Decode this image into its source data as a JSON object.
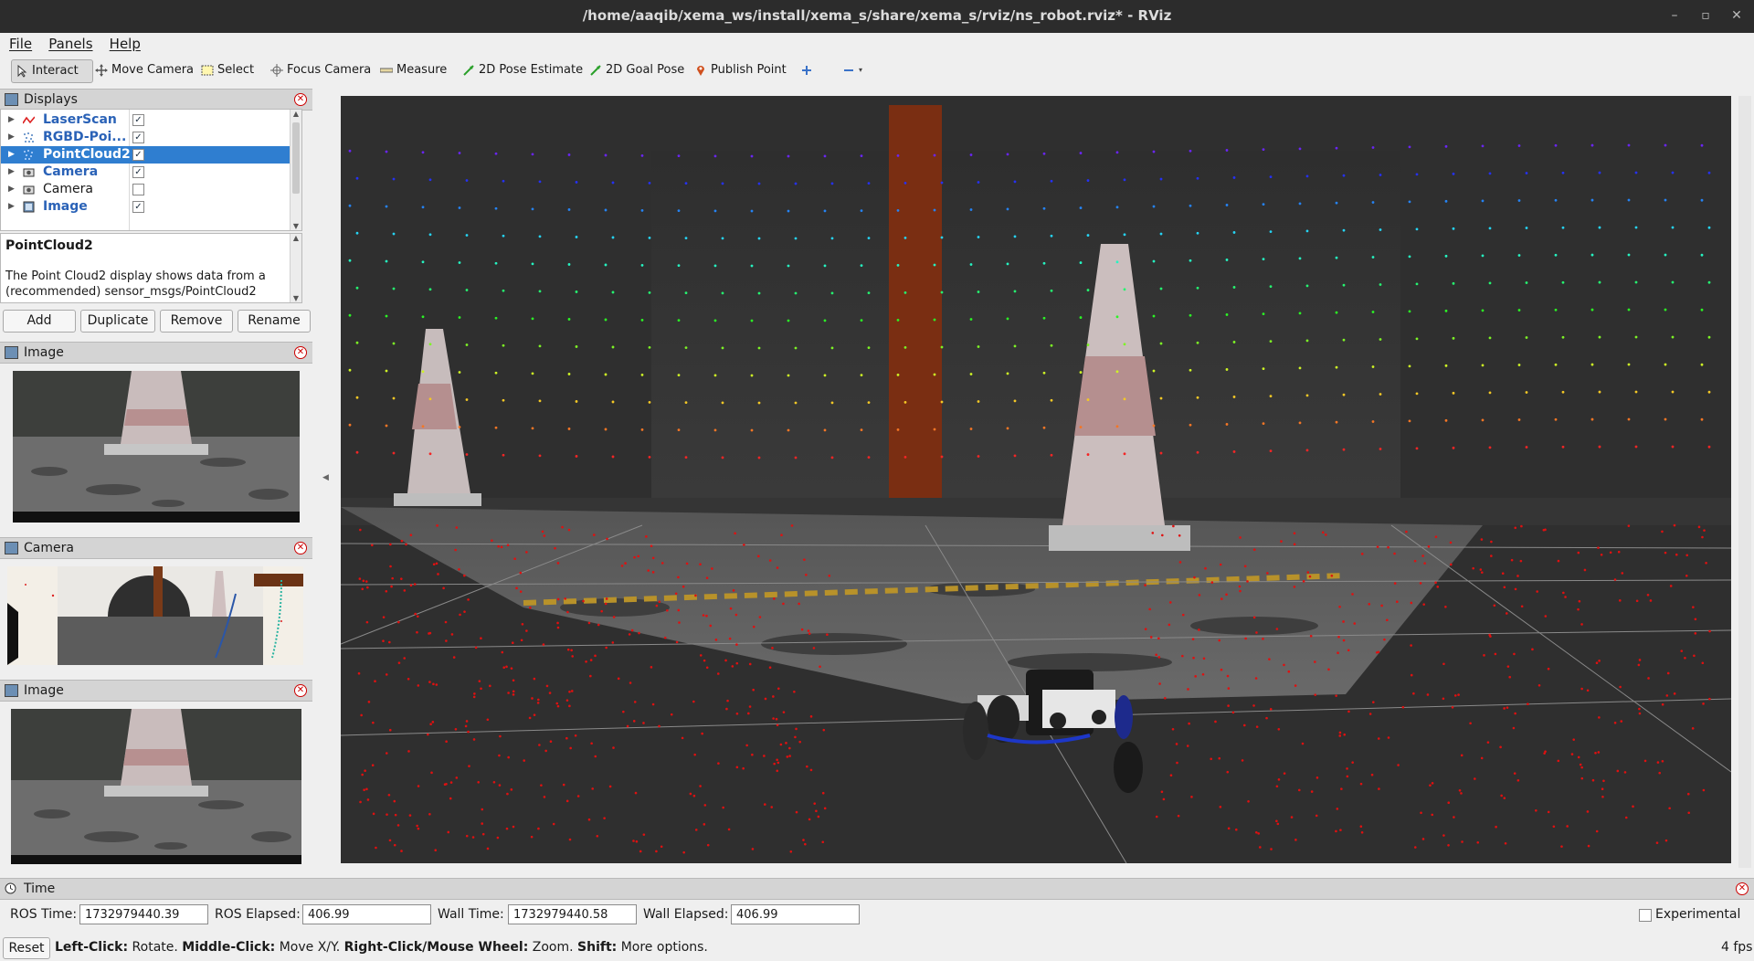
{
  "window": {
    "title": "/home/aaqib/xema_ws/install/xema_s/share/xema_s/rviz/ns_robot.rviz* - RViz",
    "controls": [
      "–",
      "▫",
      "✕"
    ]
  },
  "menu": [
    "File",
    "Panels",
    "Help"
  ],
  "toolbar": {
    "interact": "Interact",
    "move_camera": "Move Camera",
    "select": "Select",
    "focus_camera": "Focus Camera",
    "measure": "Measure",
    "pose_estimate": "2D Pose Estimate",
    "goal_pose": "2D Goal Pose",
    "publish_point": "Publish Point"
  },
  "displays_panel": {
    "title": "Displays",
    "items": [
      {
        "label": "LaserScan",
        "checked": true,
        "style": "bold"
      },
      {
        "label": "RGBD-Poi...",
        "checked": true,
        "style": "bold"
      },
      {
        "label": "PointCloud2",
        "checked": true,
        "style": "selected"
      },
      {
        "label": "Camera",
        "checked": true,
        "style": "bold"
      },
      {
        "label": "Camera",
        "checked": false,
        "style": "plain"
      },
      {
        "label": "Image",
        "checked": true,
        "style": "bold"
      }
    ],
    "description_title": "PointCloud2",
    "description_body": "The Point Cloud2 display shows data from a (recommended) sensor_msgs/PointCloud2",
    "buttons": {
      "add": "Add",
      "duplicate": "Duplicate",
      "remove": "Remove",
      "rename": "Rename"
    }
  },
  "image_panel_1": {
    "title": "Image"
  },
  "camera_panel": {
    "title": "Camera"
  },
  "image_panel_2": {
    "title": "Image"
  },
  "time_panel": {
    "title": "Time",
    "ros_time_label": "ROS Time:",
    "ros_time": "1732979440.39",
    "ros_elapsed_label": "ROS Elapsed:",
    "ros_elapsed": "406.99",
    "wall_time_label": "Wall Time:",
    "wall_time": "1732979440.58",
    "wall_elapsed_label": "Wall Elapsed:",
    "wall_elapsed": "406.99",
    "experimental": "Experimental",
    "reset": "Reset",
    "hint_left_click": "Left-Click:",
    "hint_left_text": " Rotate. ",
    "hint_middle_click": "Middle-Click:",
    "hint_middle_text": " Move X/Y. ",
    "hint_right_click": "Right-Click/Mouse Wheel:",
    "hint_right_text": " Zoom. ",
    "hint_shift": "Shift:",
    "hint_shift_text": " More options.",
    "fps": "4 fps"
  },
  "colors": {
    "selection": "#2f7ed0",
    "display_label": "#2a62b7",
    "viewport_bg": "#303030",
    "pillar": "#7a2e12",
    "laser": "#e01010"
  }
}
